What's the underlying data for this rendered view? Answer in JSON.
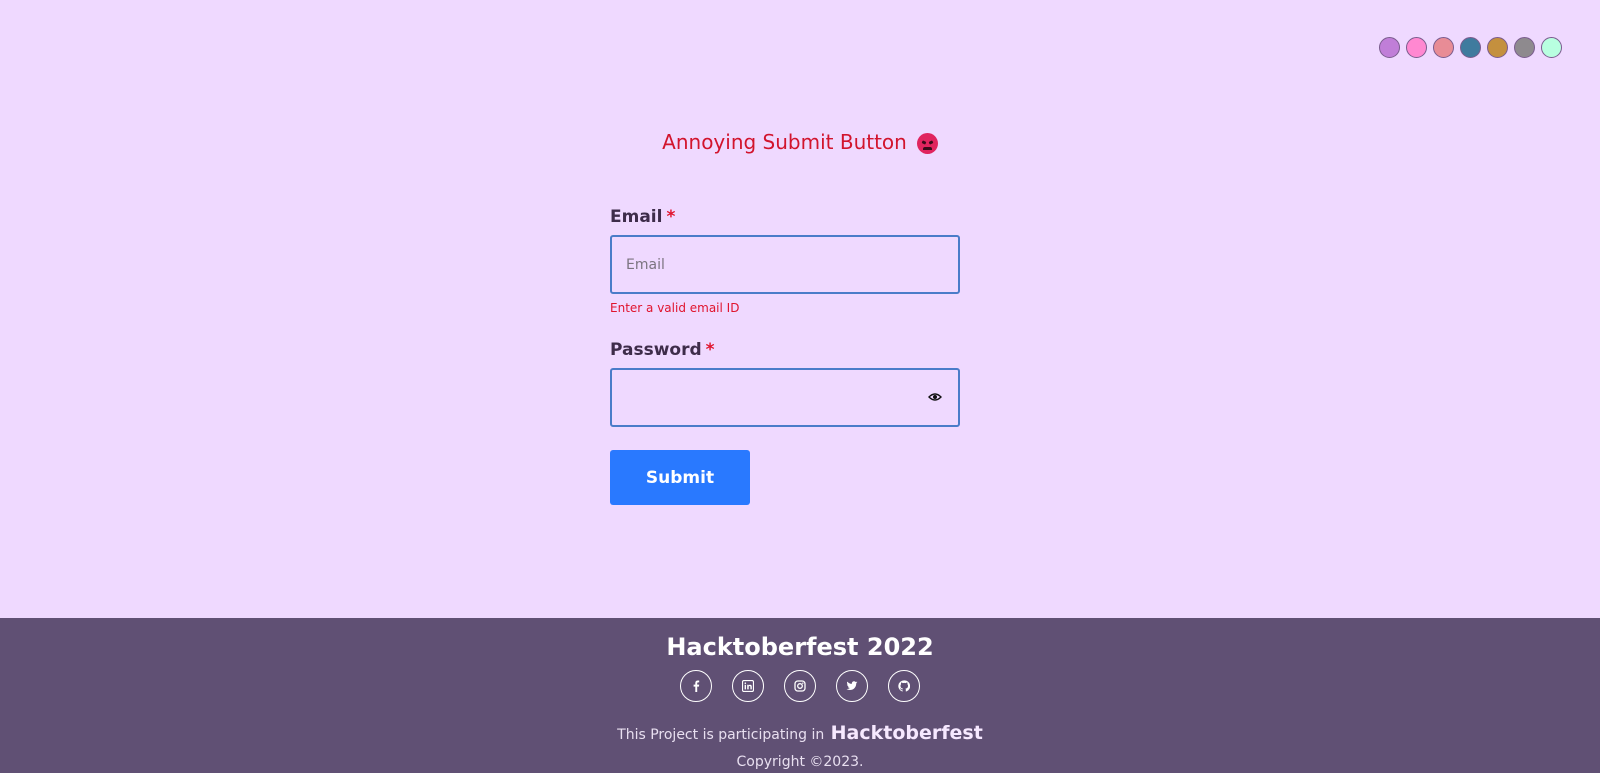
{
  "themes": [
    {
      "color": "#c07ed8"
    },
    {
      "color": "#ff88d1"
    },
    {
      "color": "#e88c96"
    },
    {
      "color": "#3f7b9e"
    },
    {
      "color": "#c4903e"
    },
    {
      "color": "#8e8a8e"
    },
    {
      "color": "#b8ffe0"
    }
  ],
  "header": {
    "title": "Annoying Submit Button",
    "title_icon": "angry-face-icon"
  },
  "form": {
    "email": {
      "label": "Email",
      "required_mark": "*",
      "placeholder": "Email",
      "value": "",
      "error": "Enter a valid email ID"
    },
    "password": {
      "label": "Password",
      "required_mark": "*",
      "value": "",
      "toggle_icon": "eye-icon"
    },
    "submit_label": "Submit"
  },
  "footer": {
    "title": "Hacktoberfest 2022",
    "socials": [
      {
        "icon": "facebook-icon"
      },
      {
        "icon": "linkedin-icon"
      },
      {
        "icon": "instagram-icon"
      },
      {
        "icon": "twitter-icon"
      },
      {
        "icon": "github-icon"
      }
    ],
    "participating_text": "This Project is participating in",
    "brand": "Hacktoberfest",
    "copyright": "Copyright ©2023."
  },
  "colors": {
    "background": "#efd9ff",
    "title": "#d2142d",
    "accent": "#2979ff",
    "footer": "#605074"
  }
}
